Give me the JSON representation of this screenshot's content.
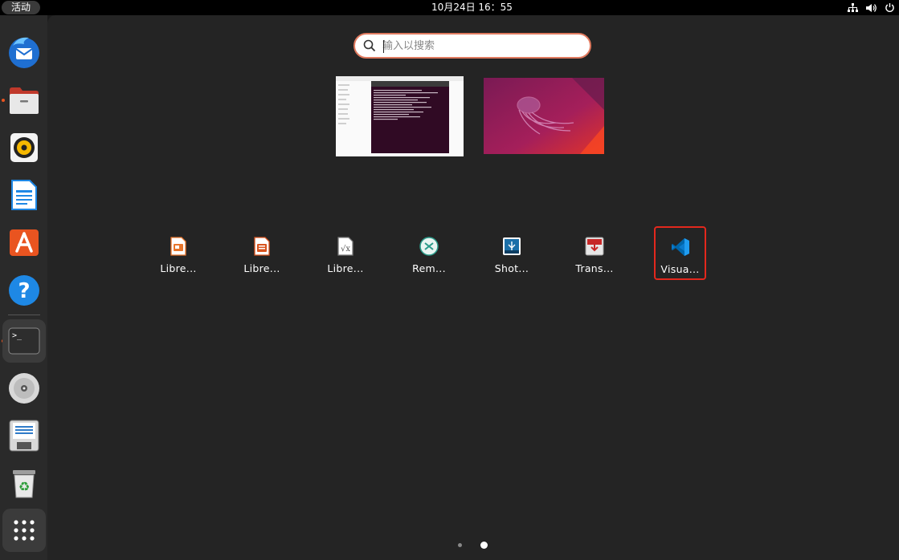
{
  "topbar": {
    "activities_label": "活动",
    "clock": "10月24日  16：55",
    "tray_icons": [
      "network-icon",
      "volume-icon",
      "power-icon"
    ]
  },
  "dock": {
    "items": [
      {
        "name": "Thunderbird",
        "icon": "thunderbird-icon",
        "running": false
      },
      {
        "name": "Files",
        "icon": "files-icon",
        "running": true
      },
      {
        "name": "Rhythmbox",
        "icon": "rhythmbox-icon",
        "running": false
      },
      {
        "name": "LibreOffice Writer",
        "icon": "writer-icon",
        "running": false
      },
      {
        "name": "Ubuntu Software",
        "icon": "software-icon",
        "running": false
      },
      {
        "name": "Help",
        "icon": "help-icon",
        "running": false
      },
      {
        "name": "Terminal",
        "icon": "terminal-icon",
        "running": true
      },
      {
        "name": "Disc",
        "icon": "disc-icon",
        "running": false
      },
      {
        "name": "Save",
        "icon": "save-icon",
        "running": false
      },
      {
        "name": "Trash",
        "icon": "trash-icon",
        "running": false
      },
      {
        "name": "Show Applications",
        "icon": "app-grid-icon",
        "running": false
      }
    ]
  },
  "search": {
    "placeholder": "输入以搜索",
    "value": ""
  },
  "apps": [
    {
      "label": "Libre...",
      "icon": "libreoffice-impress-icon",
      "color": "#e8742a"
    },
    {
      "label": "Libre...",
      "icon": "libreoffice-impress-icon",
      "color": "#d9531e"
    },
    {
      "label": "Libre...",
      "icon": "libreoffice-math-icon",
      "color": "#666666"
    },
    {
      "label": "Rem...",
      "icon": "remmina-icon",
      "color": "#2b9b8a"
    },
    {
      "label": "Shot...",
      "icon": "shotwell-icon",
      "color": "#1b6fa8"
    },
    {
      "label": "Trans...",
      "icon": "transmission-icon",
      "color": "#c62828"
    },
    {
      "label": "Visua...",
      "icon": "vscode-icon",
      "color": "#0a7acc",
      "selected": true
    }
  ],
  "pagination": {
    "pages": 2,
    "current": 2
  },
  "colors": {
    "accent": "#e95420",
    "selection_border": "#e3281d",
    "search_border": "#e07a5f"
  }
}
